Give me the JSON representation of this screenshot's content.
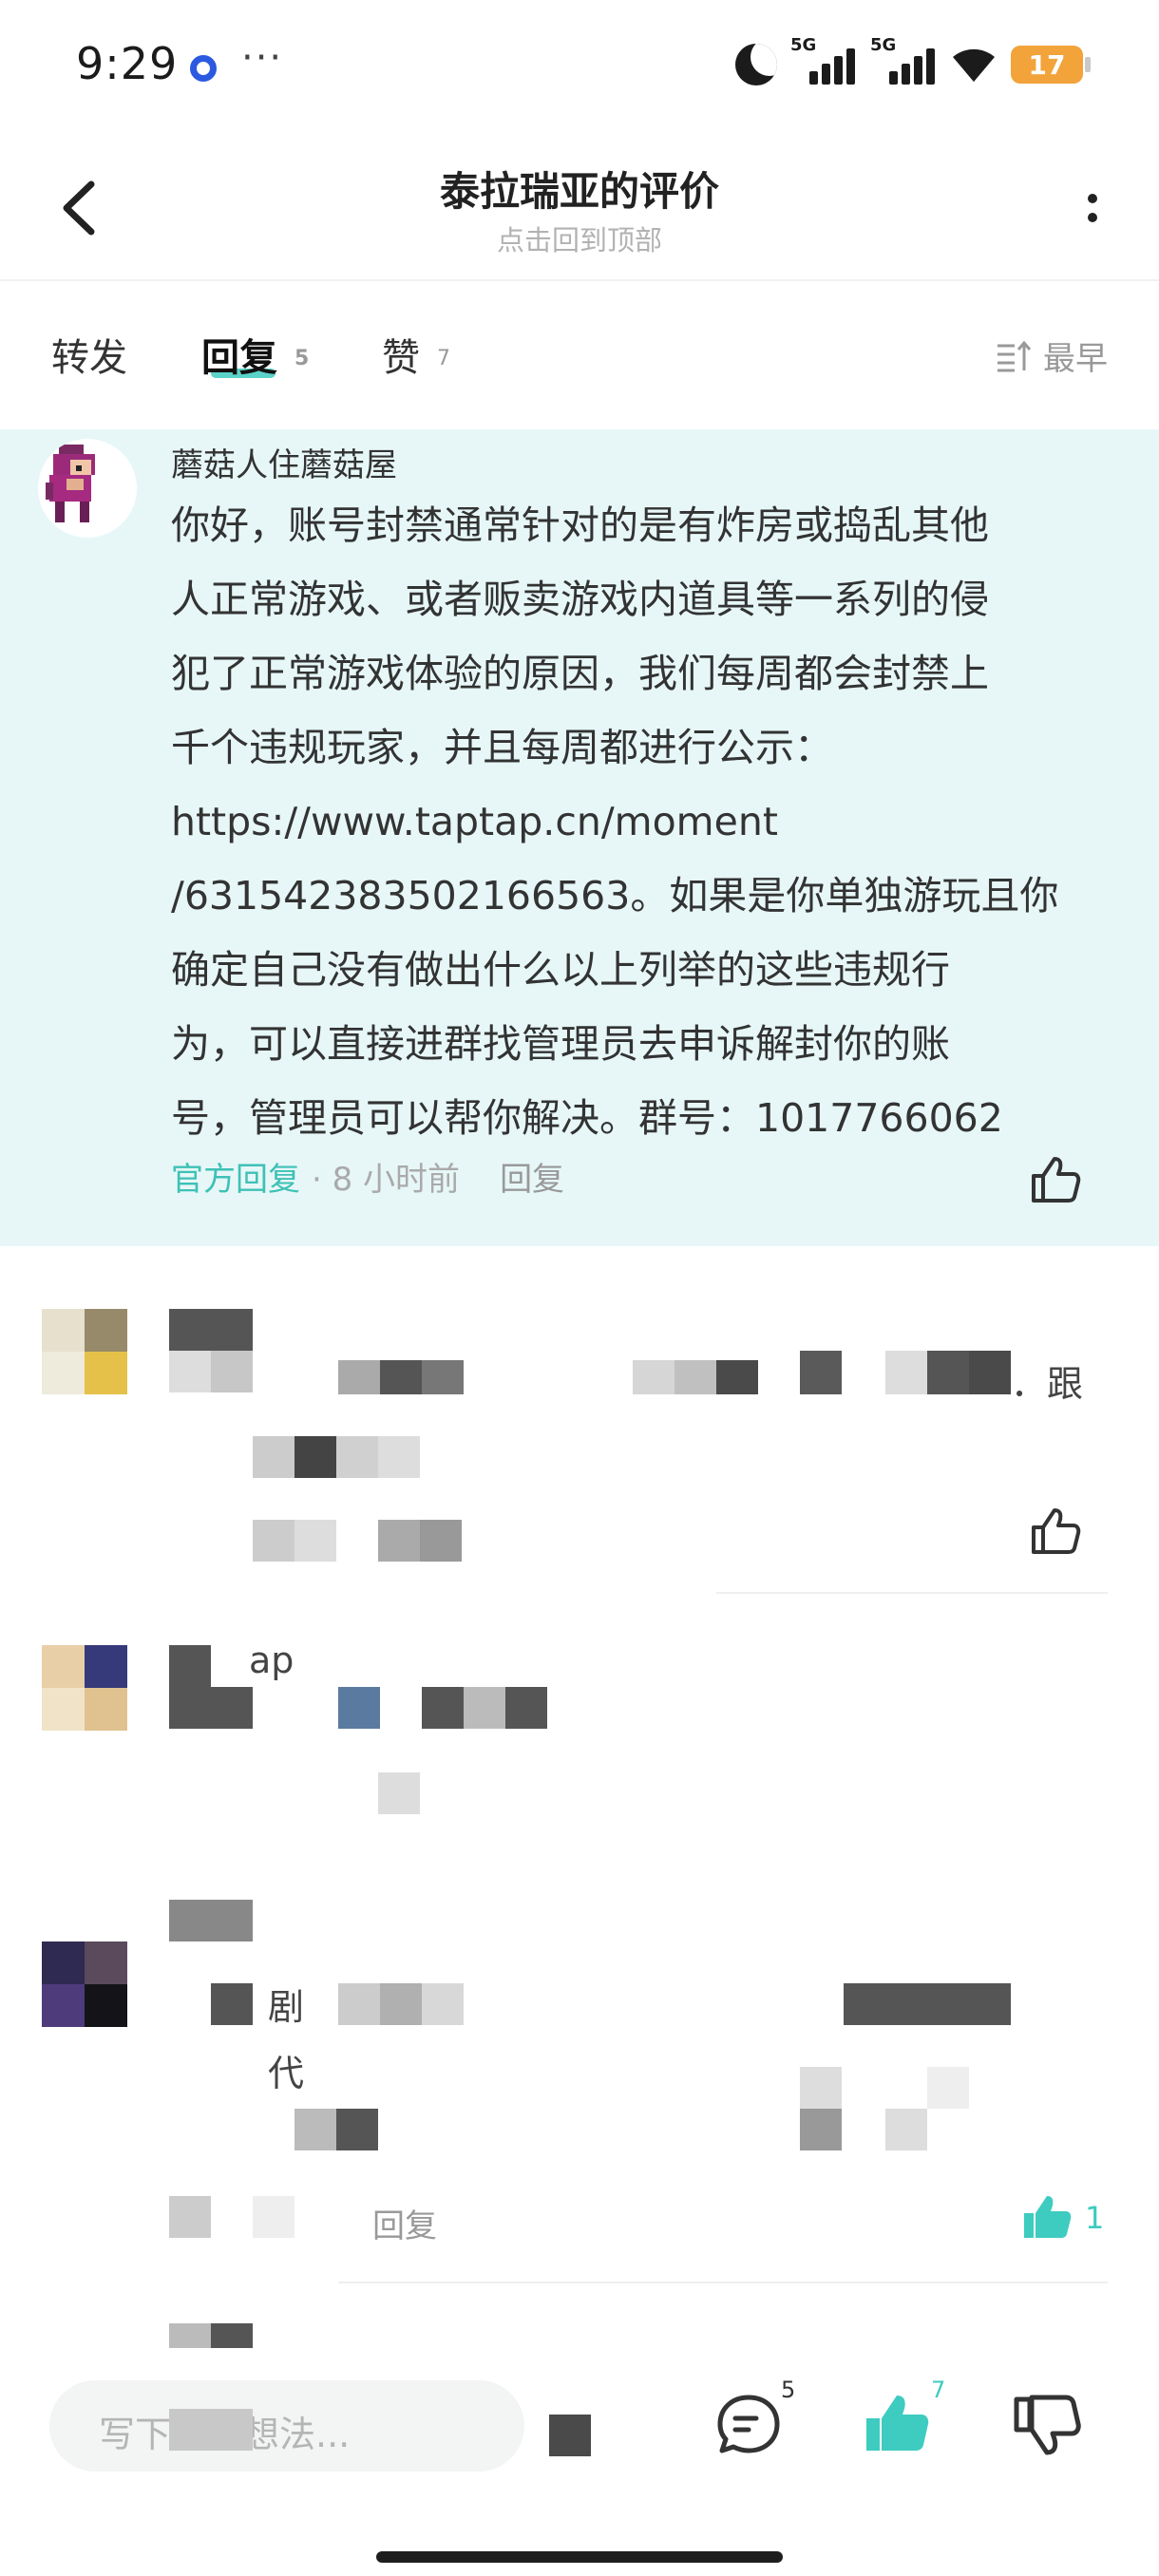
{
  "status_bar": {
    "time": "9:29",
    "more": "···",
    "network_1": "5G",
    "network_2": "5G",
    "battery": "17"
  },
  "header": {
    "title": "泰拉瑞亚的评价",
    "subtitle": "点击回到顶部"
  },
  "tabs": {
    "forward": {
      "label": "转发"
    },
    "reply": {
      "label": "回复",
      "count": "5"
    },
    "like": {
      "label": "赞",
      "count": "7"
    },
    "sort_label": "最早"
  },
  "official_reply": {
    "author": "蘑菇人住蘑菇屋",
    "body_lines": [
      "你好，账号封禁通常针对的是有炸房或捣乱其他",
      "人正常游戏、或者贩卖游戏内道具等一系列的侵",
      "犯了正常游戏体验的原因，我们每周都会封禁上",
      "千个违规玩家，并且每周都进行公示：",
      "https://www.taptap.cn/moment",
      "/631542383502166563。如果是你单独游玩且你",
      "确定自己没有做出什么以上列举的这些违规行",
      "为，可以直接进群找管理员去申诉解封你的账",
      "号，管理员可以帮你解决。群号：1017766062"
    ],
    "tag": "官方回复",
    "time": "· 8 小时前",
    "reply_action": "回复"
  },
  "blurred_rows": {
    "row1_tail": "．跟",
    "row2_fragment": "ap",
    "row3_fragment_a": "剧",
    "row3_fragment_b": "代",
    "row3_reply": "回复",
    "row3_like_count": "1"
  },
  "bottom_bar": {
    "input_placeholder": "写下你的想法...",
    "comment_count": "5",
    "like_count": "7"
  },
  "colors": {
    "accent": "#3ecbc0",
    "official_bg": "#e7f7f7",
    "battery": "#f2a33a"
  }
}
